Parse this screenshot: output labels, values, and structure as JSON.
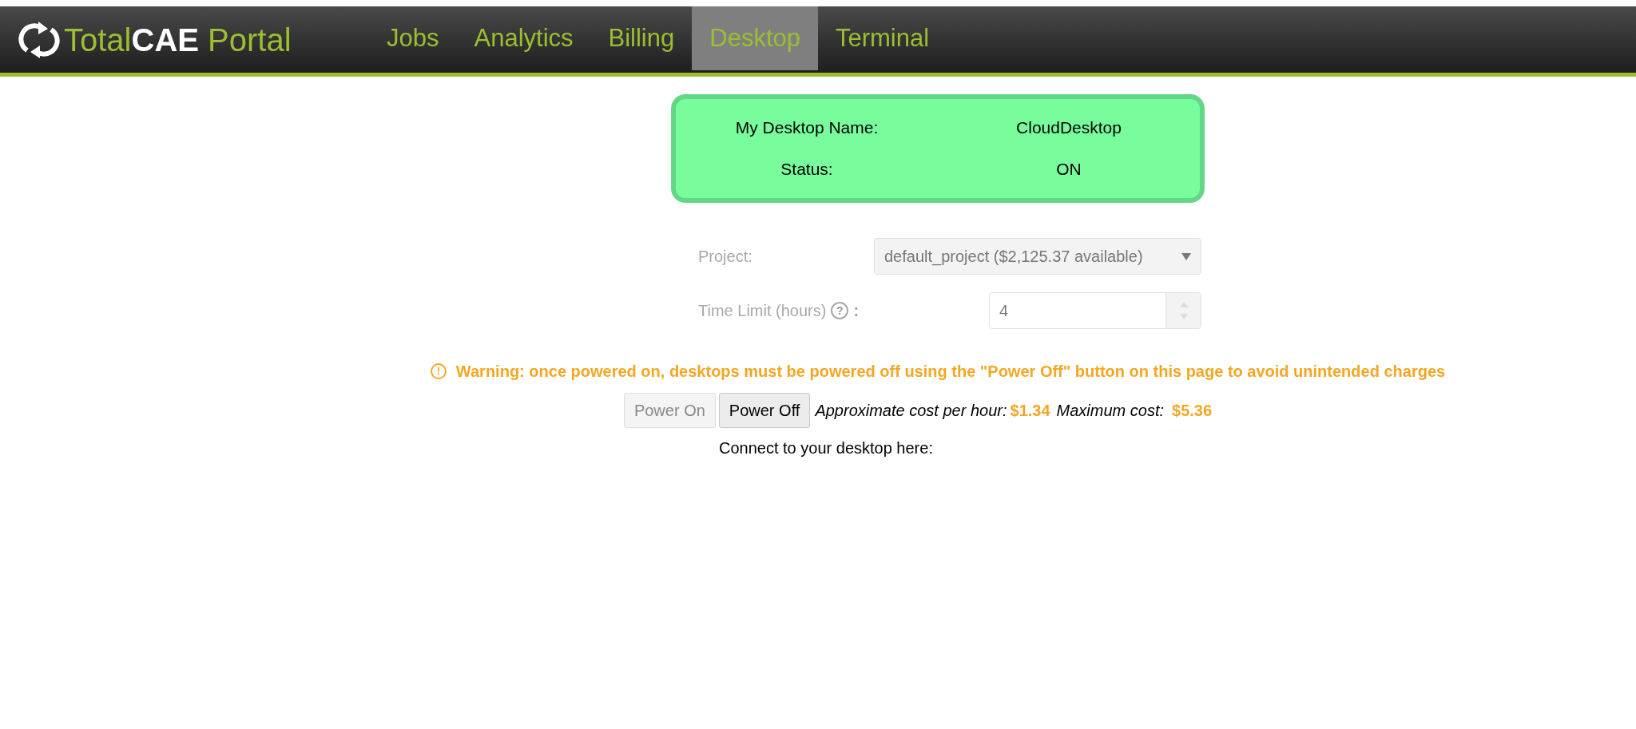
{
  "brand": {
    "light": "Total",
    "bold": "CAE",
    "suffix": "Portal"
  },
  "nav": [
    {
      "label": "Jobs",
      "selected": false
    },
    {
      "label": "Analytics",
      "selected": false
    },
    {
      "label": "Billing",
      "selected": false
    },
    {
      "label": "Desktop",
      "selected": true
    },
    {
      "label": "Terminal",
      "selected": false
    }
  ],
  "desktop_card": {
    "on": true,
    "rows": [
      {
        "label": "My Desktop Name:",
        "value": "CloudDesktop"
      },
      {
        "label": "Status:",
        "value": "ON"
      }
    ]
  },
  "form": {
    "project": {
      "label": "Project:",
      "value": "default_project ($2,125.37 available)",
      "disabled": true
    },
    "time_limit": {
      "label": "Time Limit (hours)",
      "help": "?",
      "colon": ":",
      "value": "4",
      "disabled": true
    }
  },
  "warning": {
    "icon": "!",
    "text": "Warning: once powered on, desktops must be powered off using the \"Power Off\" button on this page to avoid unintended charges"
  },
  "buttons": [
    {
      "label": "Power On",
      "disabled": true
    },
    {
      "label": "Power Off",
      "disabled": false
    }
  ],
  "cost": {
    "hour_label": "Approximate cost per hour:",
    "hour_value": "$1.34",
    "max_label": "Maximum cost:",
    "max_value": "$5.36"
  },
  "connect": {
    "label": "Connect to your desktop here:"
  }
}
